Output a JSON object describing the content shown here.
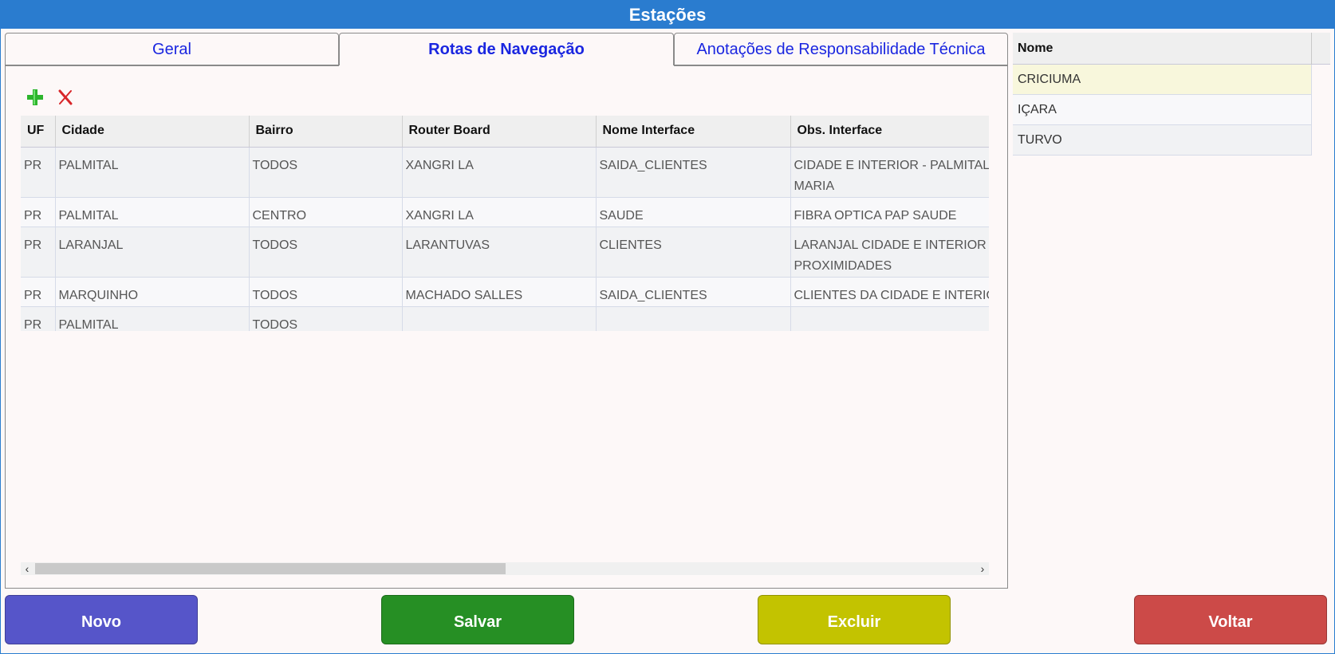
{
  "window": {
    "title": "Estações"
  },
  "tabs": [
    {
      "label": "Geral",
      "active": false
    },
    {
      "label": "Rotas de Navegação",
      "active": true
    },
    {
      "label": "Anotações de Responsabilidade Técnica",
      "active": false
    }
  ],
  "toolbar": {
    "add_icon": "plus-icon",
    "remove_icon": "x-icon",
    "add_color": "#2db52d",
    "remove_color": "#d8262a"
  },
  "grid": {
    "columns": [
      "UF",
      "Cidade",
      "Bairro",
      "Router Board",
      "Nome Interface",
      "Obs. Interface"
    ],
    "rows": [
      {
        "uf": "PR",
        "cidade": "PALMITAL",
        "bairro": "TODOS",
        "router": "XANGRI LA",
        "iface": "SAIDA_CLIENTES",
        "obs": "CIDADE E INTERIOR - PALMITAL - STA MARIA"
      },
      {
        "uf": "PR",
        "cidade": "PALMITAL",
        "bairro": "CENTRO",
        "router": "XANGRI LA",
        "iface": "SAUDE",
        "obs": "FIBRA OPTICA PAP SAUDE"
      },
      {
        "uf": "PR",
        "cidade": "LARANJAL",
        "bairro": "TODOS",
        "router": "LARANTUVAS",
        "iface": "CLIENTES",
        "obs": "LARANJAL CIDADE E INTERIOR E PROXIMIDADES"
      },
      {
        "uf": "PR",
        "cidade": "MARQUINHO",
        "bairro": "TODOS",
        "router": "MACHADO SALLES",
        "iface": "SAIDA_CLIENTES",
        "obs": "CLIENTES DA CIDADE E INTERIOR"
      },
      {
        "uf": "PR",
        "cidade": "PALMITAL",
        "bairro": "TODOS",
        "router": "",
        "iface": "",
        "obs": ""
      }
    ]
  },
  "stations": {
    "header": "Nome",
    "items": [
      "CRICIUMA",
      "IÇARA",
      "TURVO"
    ],
    "selected_index": 0
  },
  "buttons": {
    "novo": "Novo",
    "salvar": "Salvar",
    "excluir": "Excluir",
    "voltar": "Voltar"
  },
  "colors": {
    "titlebar": "#2a7ccf",
    "tab_text": "#1a26e0",
    "novo": "#5655c9",
    "salvar": "#268f24",
    "excluir": "#c3c300",
    "voltar": "#cc4a48"
  }
}
